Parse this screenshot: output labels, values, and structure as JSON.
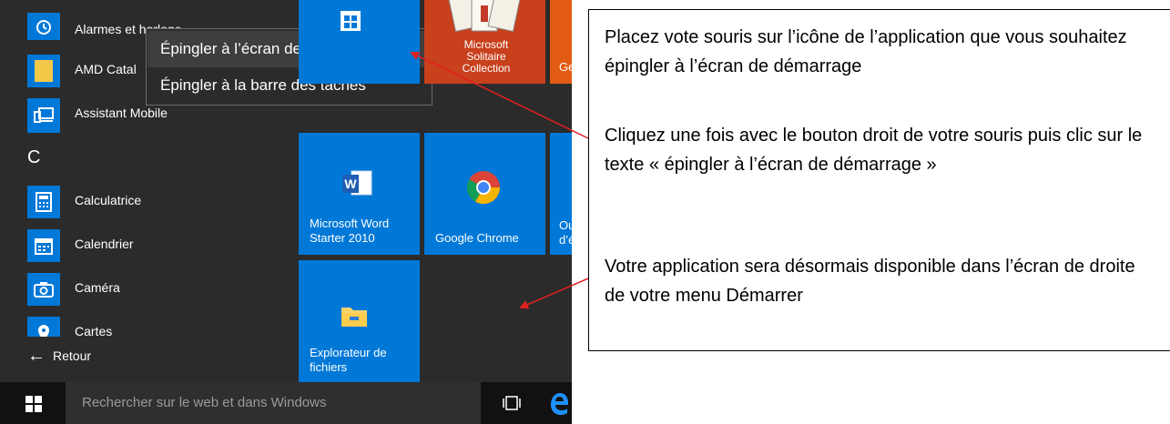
{
  "start_menu": {
    "apps": [
      {
        "label": "Alarmes et horloge",
        "icon": "alarm-clock-icon"
      },
      {
        "label": "AMD Catal",
        "icon": "folder-icon"
      },
      {
        "label": "Assistant Mobile",
        "icon": "phone-laptop-icon"
      },
      {
        "label": "Calculatrice",
        "icon": "calculator-icon"
      },
      {
        "label": "Calendrier",
        "icon": "calendar-icon"
      },
      {
        "label": "Caméra",
        "icon": "camera-icon"
      },
      {
        "label": "Cartes",
        "icon": "map-pin-icon"
      }
    ],
    "section_letter": "C",
    "back_label": "Retour"
  },
  "context_menu": {
    "items": [
      {
        "label": "Épingler à l’écran de démarrage"
      },
      {
        "label": "Épingler à la barre des tâches"
      }
    ]
  },
  "tiles": {
    "store": {
      "label": ""
    },
    "solitaire": {
      "label": "Microsoft Solitaire Collection"
    },
    "get": {
      "label": "Ge"
    },
    "word": {
      "label": "Microsoft Word Starter 2010"
    },
    "chrome": {
      "label": "Google Chrome"
    },
    "outlook": {
      "label": "Ou d’é"
    },
    "explorer": {
      "label": "Explorateur de fichiers"
    }
  },
  "taskbar": {
    "search_placeholder": "Rechercher sur le web et dans Windows"
  },
  "callout": {
    "paragraphs": [
      "Placez vote souris sur l’icône de l’application que vous souhaitez épingler à l’écran de démarrage",
      "Cliquez une fois avec le bouton droit de votre souris puis clic sur le texte « épingler à l’écran de démarrage »",
      "Votre application sera désormais disponible dans l’écran de droite de votre menu Démarrer"
    ]
  },
  "colors": {
    "accent": "#0078d7",
    "menu_bg": "#2b2b2b",
    "taskbar_bg": "#111111",
    "arrow": "#e02020",
    "solitaire_tile": "#c8401c",
    "get_tile": "#e35b12"
  }
}
